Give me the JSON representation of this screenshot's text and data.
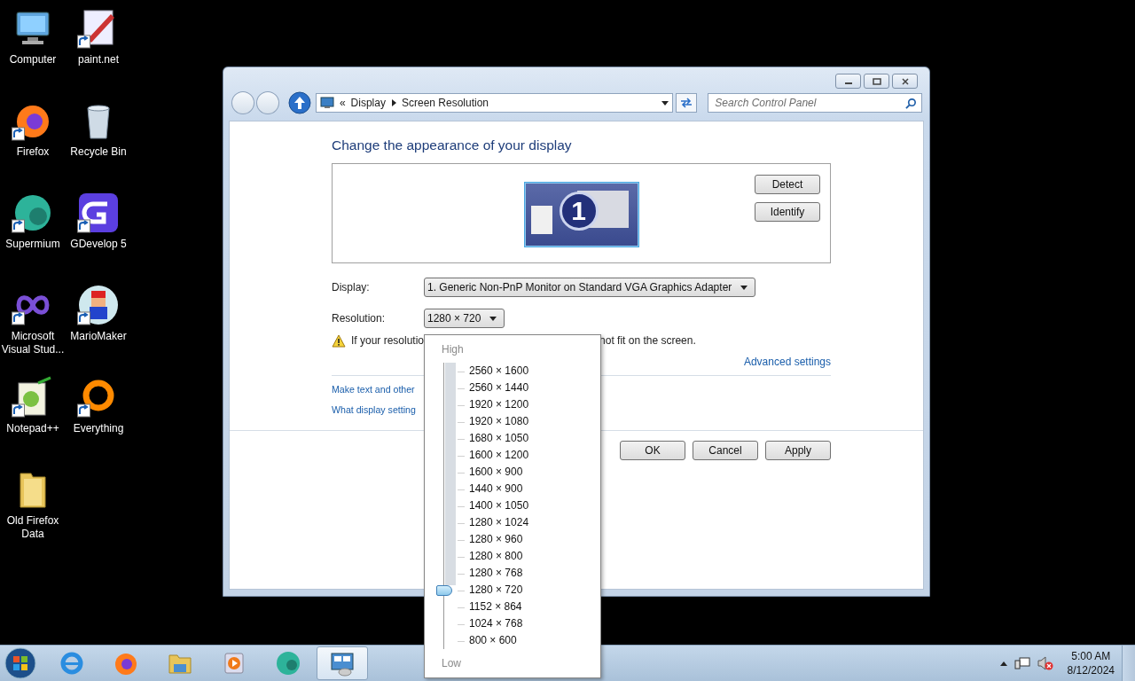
{
  "desktop_icons": [
    {
      "label": "Computer",
      "kind": "computer",
      "shortcut": false
    },
    {
      "label": "paint.net",
      "kind": "paint",
      "shortcut": true
    },
    {
      "label": "Firefox",
      "kind": "firefox",
      "shortcut": true
    },
    {
      "label": "Recycle Bin",
      "kind": "bin",
      "shortcut": false
    },
    {
      "label": "Supermium",
      "kind": "supermium",
      "shortcut": true
    },
    {
      "label": "GDevelop 5",
      "kind": "gdevelop",
      "shortcut": true
    },
    {
      "label": "Microsoft Visual Stud...",
      "kind": "vs",
      "shortcut": true
    },
    {
      "label": "MarioMaker",
      "kind": "mario",
      "shortcut": true
    },
    {
      "label": "Notepad++",
      "kind": "notepad",
      "shortcut": true
    },
    {
      "label": "Everything",
      "kind": "everything",
      "shortcut": true
    },
    {
      "label": "Old Firefox Data",
      "kind": "folder",
      "shortcut": false
    }
  ],
  "window": {
    "address": {
      "overflow_mark": "«",
      "breadcrumb": [
        "Display",
        "Screen Resolution"
      ]
    },
    "search": {
      "placeholder": "Search Control Panel"
    },
    "heading": "Change the appearance of your display",
    "monitor_number": "1",
    "side_buttons": [
      "Detect",
      "Identify"
    ],
    "display": {
      "label": "Display:",
      "value": "1. Generic Non-PnP Monitor on Standard VGA Graphics Adapter"
    },
    "resolution": {
      "label": "Resolution:",
      "value": "1280 × 720"
    },
    "warning": {
      "before": "If your resolutio",
      "after": "not fit on the screen."
    },
    "advanced_link": "Advanced settings",
    "links": [
      "Make text and other",
      "What display setting"
    ],
    "buttons": [
      "OK",
      "Cancel",
      "Apply"
    ]
  },
  "resolution_popup": {
    "high_label": "High",
    "low_label": "Low",
    "level": 0.1875,
    "options": [
      "2560 × 1600",
      "2560 × 1440",
      "1920 × 1200",
      "1920 × 1080",
      "1680 × 1050",
      "1600 × 1200",
      "1600 × 900",
      "1440 × 900",
      "1400 × 1050",
      "1280 × 1024",
      "1280 × 960",
      "1280 × 800",
      "1280 × 768",
      "1280 × 720",
      "1152 × 864",
      "1024 × 768",
      "800 × 600"
    ]
  },
  "taskbar": {
    "items": [
      {
        "kind": "ie",
        "active": false
      },
      {
        "kind": "firefox",
        "active": false
      },
      {
        "kind": "explorer",
        "active": false
      },
      {
        "kind": "media",
        "active": false
      },
      {
        "kind": "supermium",
        "active": false
      },
      {
        "kind": "control-panel",
        "active": true
      }
    ],
    "clock": {
      "time": "5:00 AM",
      "date": "8/12/2024"
    }
  }
}
